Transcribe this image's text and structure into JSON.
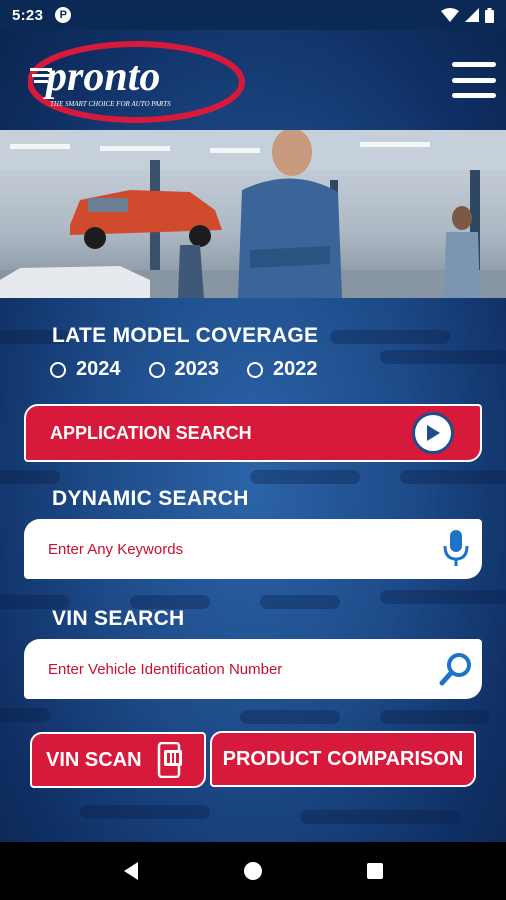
{
  "status_bar": {
    "time": "5:23",
    "app_icon": "P"
  },
  "header": {
    "logo_text": "pronto",
    "tagline": "THE SMART CHOICE FOR AUTO PARTS"
  },
  "coverage": {
    "title": "LATE MODEL COVERAGE",
    "years": [
      "2024",
      "2023",
      "2022"
    ]
  },
  "application_search": {
    "label": "APPLICATION SEARCH"
  },
  "dynamic_search": {
    "title": "DYNAMIC SEARCH",
    "placeholder": "Enter Any Keywords"
  },
  "vin_search": {
    "title": "VIN SEARCH",
    "placeholder": "Enter Vehicle Identification Number"
  },
  "buttons": {
    "vin_scan": "VIN SCAN",
    "product_comparison": "PRODUCT COMPARISON"
  },
  "colors": {
    "brand_red": "#d71a3b",
    "brand_blue": "#1d4a88",
    "dark_blue": "#0a2550"
  }
}
